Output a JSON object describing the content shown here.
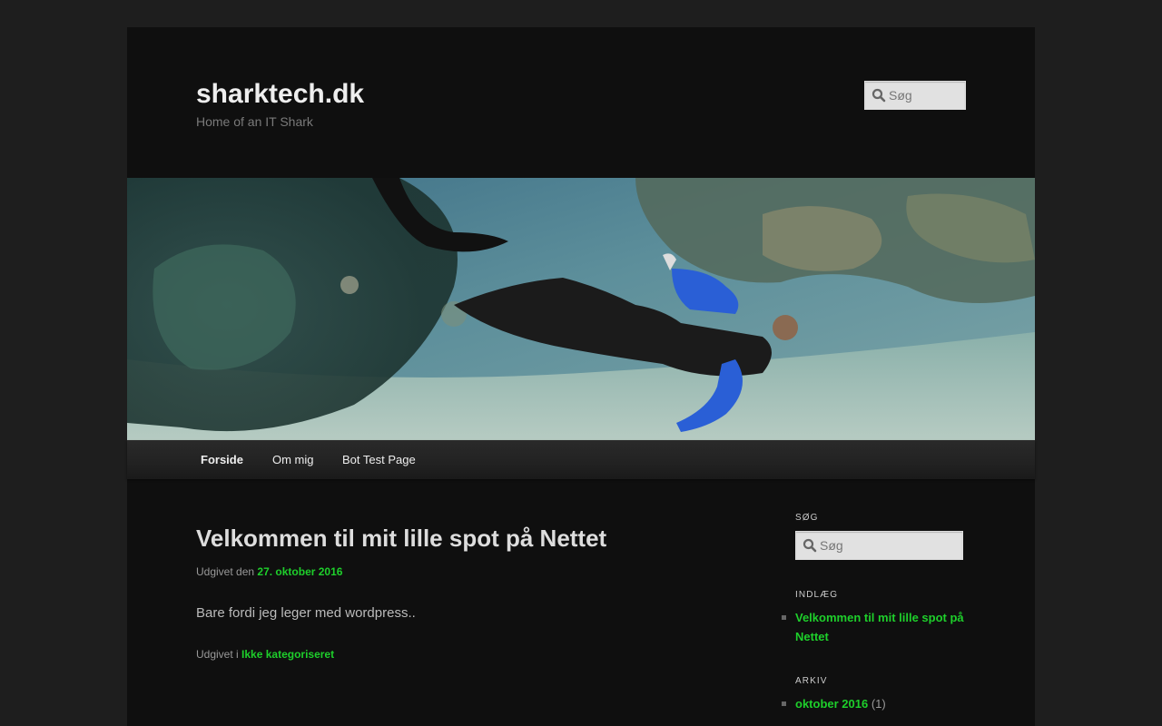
{
  "site": {
    "title": "sharktech.dk",
    "description": "Home of an IT Shark"
  },
  "header_search": {
    "placeholder": "Søg"
  },
  "banner": {
    "alt": "Freediver in a black and blue wetsuit swimming over a coral reef"
  },
  "nav": {
    "items": [
      {
        "label": "Forside",
        "current": true
      },
      {
        "label": "Om mig",
        "current": false
      },
      {
        "label": "Bot Test Page",
        "current": false
      }
    ]
  },
  "post": {
    "title": "Velkommen til mit lille spot på Nettet",
    "posted_prefix": "Udgivet den",
    "date": "27. oktober 2016",
    "content": "Bare fordi jeg leger med wordpress..",
    "category_prefix": "Udgivet i",
    "category": "Ikke kategoriseret"
  },
  "sidebar": {
    "search": {
      "title": "SØG",
      "placeholder": "Søg"
    },
    "recent": {
      "title": "INDLÆG",
      "items": [
        {
          "label": "Velkommen til mit lille spot på Nettet"
        }
      ]
    },
    "archive": {
      "title": "ARKIV",
      "items": [
        {
          "label": "oktober 2016",
          "count": "(1)"
        }
      ]
    }
  },
  "colors": {
    "link": "#1ecf2b",
    "background": "#1e1e1e",
    "page": "#0f0f0f"
  }
}
